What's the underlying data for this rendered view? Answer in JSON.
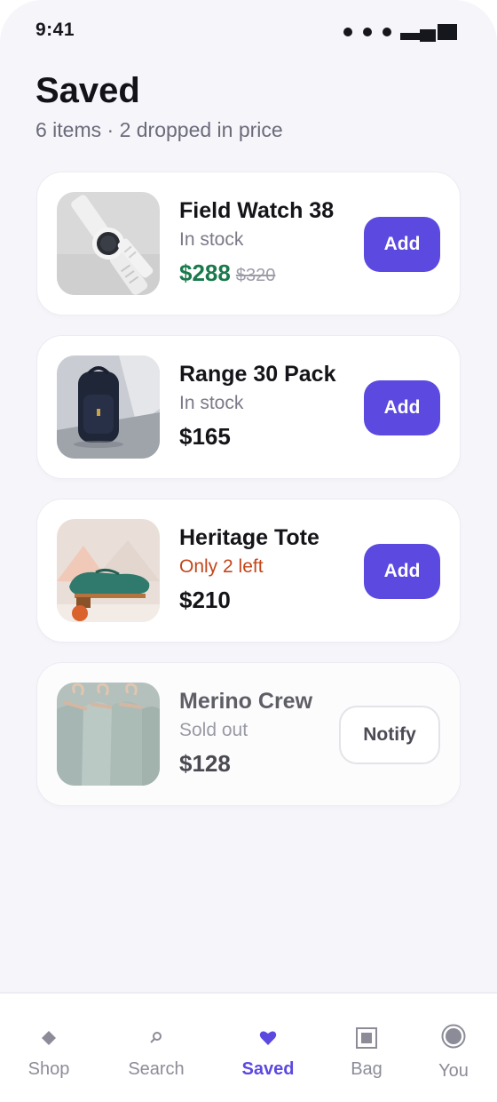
{
  "status_bar": {
    "time": "9:41"
  },
  "header": {
    "title": "Saved",
    "subtitle": "6 items · 2 dropped in price"
  },
  "items": [
    {
      "name": "Field Watch 38",
      "status": "In stock",
      "price": "$288",
      "old_price": "$320",
      "action": "Add",
      "image": "watch"
    },
    {
      "name": "Range 30 Pack",
      "status": "In stock",
      "price": "$165",
      "action": "Add",
      "image": "backpack"
    },
    {
      "name": "Heritage Tote",
      "status": "Only 2 left",
      "price": "$210",
      "action": "Add",
      "image": "shoe"
    },
    {
      "name": "Merino Crew",
      "status": "Sold out",
      "price": "$128",
      "action": "Notify",
      "image": "sweaters"
    }
  ],
  "tab_bar": {
    "tabs": [
      {
        "label": "Shop",
        "icon": "diamond-icon"
      },
      {
        "label": "Search",
        "icon": "search-icon"
      },
      {
        "label": "Saved",
        "icon": "heart-icon",
        "active": true
      },
      {
        "label": "Bag",
        "icon": "bag-icon"
      },
      {
        "label": "You",
        "icon": "profile-icon"
      }
    ]
  },
  "colors": {
    "accent": "#5b49e0",
    "sale_price": "#1a7a4c",
    "low_stock": "#c4461b",
    "background": "#f5f5fa"
  }
}
